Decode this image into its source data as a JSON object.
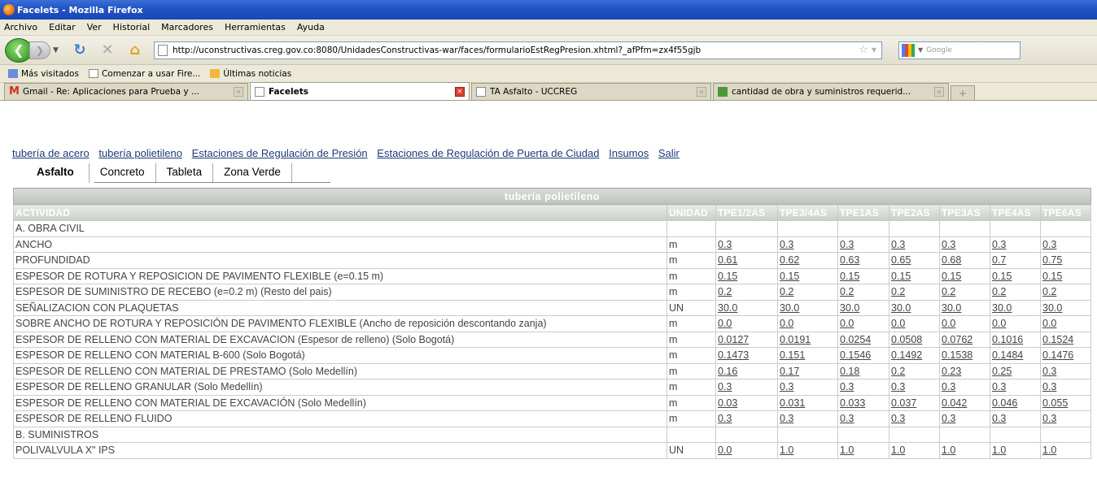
{
  "window": {
    "title": "Facelets - Mozilla Firefox"
  },
  "menu": [
    "Archivo",
    "Editar",
    "Ver",
    "Historial",
    "Marcadores",
    "Herramientas",
    "Ayuda"
  ],
  "url": "http://uconstructivas.creg.gov.co:8080/UnidadesConstructivas-war/faces/formularioEstRegPresion.xhtml?_afPfm=zx4f55gjb",
  "search_placeholder": "Google",
  "bookmarks": [
    "Más visitados",
    "Comenzar a usar Fire...",
    "Últimas noticias"
  ],
  "browser_tabs": [
    {
      "label": "Gmail - Re: Aplicaciones para Prueba y ..."
    },
    {
      "label": "Facelets"
    },
    {
      "label": "TA Asfalto - UCCREG"
    },
    {
      "label": "cantidad de obra y suministros requerid..."
    }
  ],
  "top_links": [
    "tubería de acero",
    "tubería polietileno",
    "Estaciones de Regulación de Presión",
    "Estaciones de Regulación de Puerta de Ciudad",
    "Insumos",
    "Salir"
  ],
  "app_tabs": [
    "Asfalto",
    "Concreto",
    "Tableta",
    "Zona Verde"
  ],
  "table": {
    "caption": "tubería polietileno",
    "headers": [
      "ACTIVIDAD",
      "UNIDAD",
      "TPE1/2AS",
      "TPE3/4AS",
      "TPE1AS",
      "TPE2AS",
      "TPE3AS",
      "TPE4AS",
      "TPE6AS"
    ],
    "rows": [
      {
        "actividad": "A. OBRA CIVIL",
        "unidad": "",
        "values": []
      },
      {
        "actividad": "ANCHO",
        "unidad": "m",
        "values": [
          "0.3",
          "0.3",
          "0.3",
          "0.3",
          "0.3",
          "0.3",
          "0.3"
        ]
      },
      {
        "actividad": "PROFUNDIDAD",
        "unidad": "m",
        "values": [
          "0.61",
          "0.62",
          "0.63",
          "0.65",
          "0.68",
          "0.7",
          "0.75"
        ]
      },
      {
        "actividad": "ESPESOR DE ROTURA Y REPOSICION DE PAVIMENTO FLEXIBLE (e=0.15 m)",
        "unidad": "m",
        "values": [
          "0.15",
          "0.15",
          "0.15",
          "0.15",
          "0.15",
          "0.15",
          "0.15"
        ]
      },
      {
        "actividad": "ESPESOR DE SUMINISTRO DE RECEBO (e=0.2 m) (Resto del pais)",
        "unidad": "m",
        "values": [
          "0.2",
          "0.2",
          "0.2",
          "0.2",
          "0.2",
          "0.2",
          "0.2"
        ]
      },
      {
        "actividad": "SEÑALIZACION CON PLAQUETAS",
        "unidad": "UN",
        "values": [
          "30.0",
          "30.0",
          "30.0",
          "30.0",
          "30.0",
          "30.0",
          "30.0"
        ]
      },
      {
        "actividad": "SOBRE ANCHO DE ROTURA Y REPOSICIÓN DE PAVIMENTO FLEXIBLE (Ancho de reposición descontando zanja)",
        "unidad": "m",
        "values": [
          "0.0",
          "0.0",
          "0.0",
          "0.0",
          "0.0",
          "0.0",
          "0.0"
        ]
      },
      {
        "actividad": "ESPESOR DE RELLENO CON MATERIAL DE EXCAVACION (Espesor de relleno) (Solo Bogotá)",
        "unidad": "m",
        "values": [
          "0.0127",
          "0.0191",
          "0.0254",
          "0.0508",
          "0.0762",
          "0.1016",
          "0.1524"
        ]
      },
      {
        "actividad": "ESPESOR DE RELLENO CON MATERIAL B-600 (Solo Bogotá)",
        "unidad": "m",
        "values": [
          "0.1473",
          "0.151",
          "0.1546",
          "0.1492",
          "0.1538",
          "0.1484",
          "0.1476"
        ]
      },
      {
        "actividad": "ESPESOR DE RELLENO CON MATERIAL DE PRESTAMO (Solo Medellín)",
        "unidad": "m",
        "values": [
          "0.16",
          "0.17",
          "0.18",
          "0.2",
          "0.23",
          "0.25",
          "0.3"
        ]
      },
      {
        "actividad": "ESPESOR DE RELLENO GRANULAR (Solo Medellín)",
        "unidad": "m",
        "values": [
          "0.3",
          "0.3",
          "0.3",
          "0.3",
          "0.3",
          "0.3",
          "0.3"
        ]
      },
      {
        "actividad": "ESPESOR DE RELLENO CON MATERIAL DE EXCAVACIÓN (Solo Medellín)",
        "unidad": "m",
        "values": [
          "0.03",
          "0.031",
          "0.033",
          "0.037",
          "0.042",
          "0.046",
          "0.055"
        ]
      },
      {
        "actividad": "ESPESOR DE RELLENO FLUIDO",
        "unidad": "m",
        "values": [
          "0.3",
          "0.3",
          "0.3",
          "0.3",
          "0.3",
          "0.3",
          "0.3"
        ]
      },
      {
        "actividad": "B. SUMINISTROS",
        "unidad": "",
        "values": []
      },
      {
        "actividad": "POLIVALVULA X\" IPS",
        "unidad": "UN",
        "values": [
          "0.0",
          "1.0",
          "1.0",
          "1.0",
          "1.0",
          "1.0",
          "1.0"
        ]
      }
    ]
  }
}
